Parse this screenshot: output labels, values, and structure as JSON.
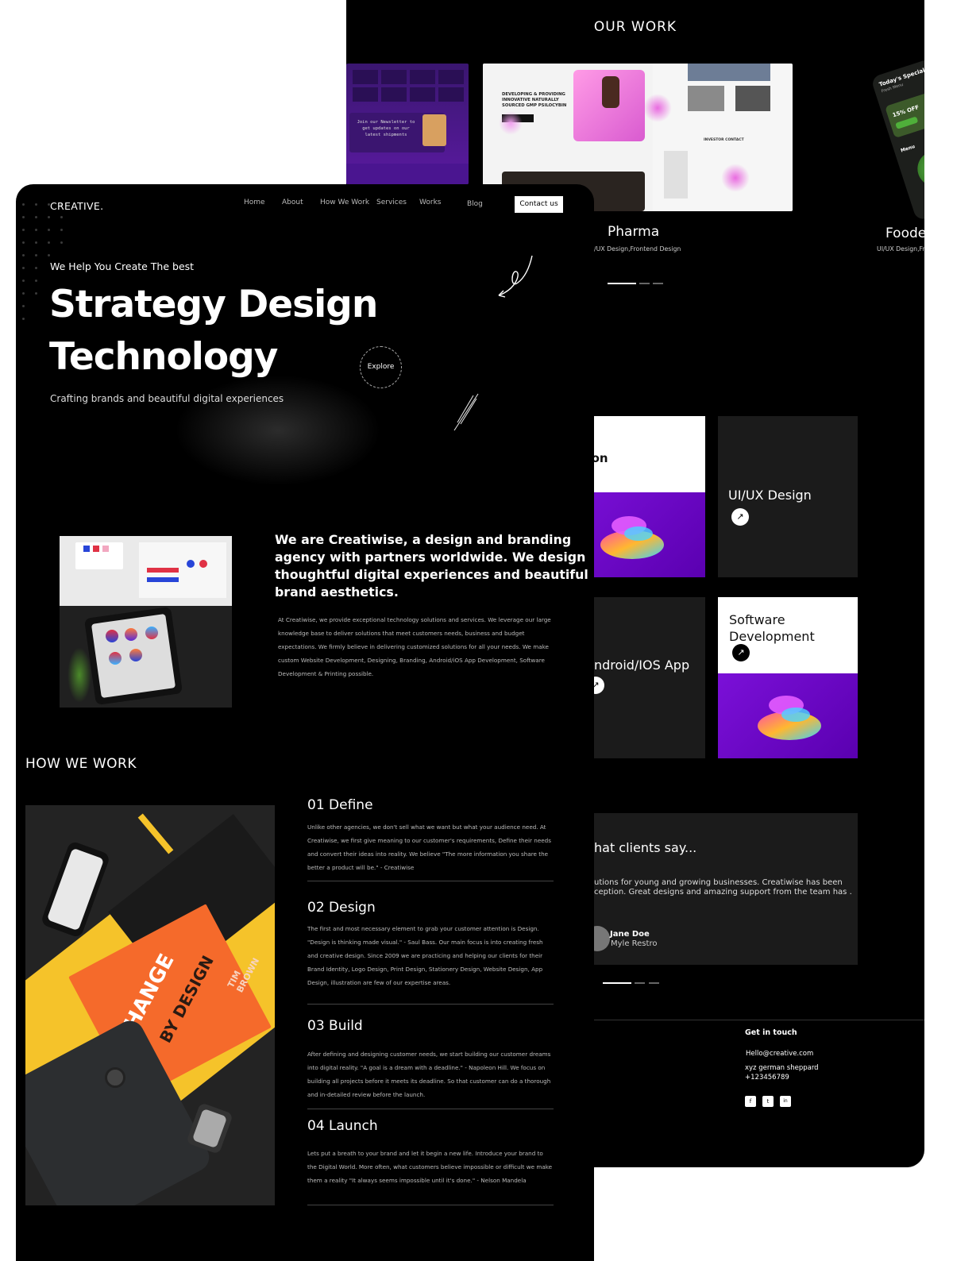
{
  "work": {
    "heading": "OUR WORK",
    "projects": [
      {
        "title": "Pharma",
        "subtitle": "UI/UX Design,Frontend Design"
      },
      {
        "title": "Foode",
        "subtitle": "UI/UX Design,Fr"
      }
    ],
    "mock_newsletter": "Join our Newsletter to get updates on our latest shipments",
    "mock_pharma_headline": "DEVELOPING & PROVIDING INNOVATIVE NATURALLY SOURCED GMP PSILOCYBIN",
    "mock_investor": "INVESTOR CONTACT",
    "mock_food_title": "Today's Special",
    "mock_food_sub": "Fresh Menu",
    "mock_food_offer": "15% OFF",
    "mock_food_menu": "Menu"
  },
  "header": {
    "logo": "CREATIVE.",
    "nav": [
      "Home",
      "About",
      "How We Work",
      "Services",
      "Works",
      "Blog"
    ],
    "contact": "Contact us"
  },
  "hero": {
    "eyebrow": "We Help You Create The best",
    "line1": "Strategy Design",
    "line2": "Technology",
    "subtitle": "Crafting brands and beautiful digital experiences",
    "cta": "Explore"
  },
  "about": {
    "headline": "We are Creatiwise, a design and branding agency with partners worldwide. We design thoughtful digital experiences and beautiful brand aesthetics.",
    "body": "At Creatiwise, we provide exceptional technology solutions and services. We leverage our large knowledge base to deliver solutions that meet customers needs, business and budget expectations. We firmly believe in delivering customized solutions for all your needs. We make custom Website Development, Designing, Branding, Android/iOS App Development, Software Development & Printing possible."
  },
  "services": [
    {
      "label": "ustration"
    },
    {
      "label": "UI/UX Design"
    },
    {
      "label": "ndroid/IOS App"
    },
    {
      "label": "Software Development"
    }
  ],
  "how": {
    "heading": "HOW WE WORK",
    "steps": [
      {
        "title": "01 Define",
        "body": "Unlike other agencies, we don't sell what we want but what your audience need. At Creatiwise, we first give meaning to our customer's requirements, Define their needs and convert their ideas into reality. We believe \"The more information you share the better a product will be.\" - Creatiwise"
      },
      {
        "title": "02 Design",
        "body": "The first and most necessary element to grab your customer attention is Design. \"Design is thinking made visual.\" - Saul Bass. Our main focus is into creating fresh and creative design. Since 2009 we are practicing and helping our clients for their Brand Identity, Logo Design, Print Design, Stationery Design, Website Design, App Design, illustration are few of our expertise areas."
      },
      {
        "title": "03 Build",
        "body": "After defining and designing customer needs, we start building our customer dreams into digital reality. \"A goal is a dream with a deadline.\" - Napoleon Hill. We focus on building all projects before it meets its deadline. So that customer can do a thorough and in-detailed review before the launch."
      },
      {
        "title": "04 Launch",
        "body": "Lets put a breath to your brand and let it begin a new life. Introduce your brand to the Digital World. More often, what customers believe impossible or difficult we make them a reality \"It always seems impossible until it's done.\" - Nelson Mandela"
      }
    ],
    "book_line1": "CHANGE",
    "book_line2": "BY DESIGN",
    "book_author": "TIM BROWN"
  },
  "testimonial": {
    "heading": "hat clients say...",
    "quote": "utions for young and growing businesses. Creatiwise has been ception. Great designs and amazing support from the team has .",
    "name": "Jane Doe",
    "company": "Myle Restro"
  },
  "footer": {
    "heading": "Get in touch",
    "email": "Hello@creative.com",
    "address": "xyz german sheppard",
    "phone": "+123456789",
    "social": [
      "f",
      "t",
      "in"
    ]
  },
  "colors": {
    "accent_purple": "#6a00c8",
    "background": "#000000",
    "card": "#1b1b1b"
  }
}
